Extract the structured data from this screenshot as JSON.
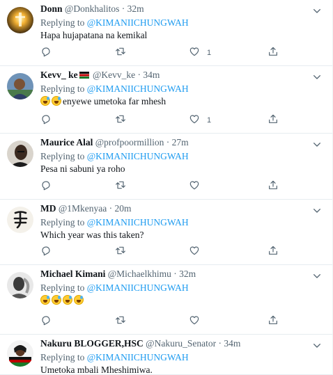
{
  "replying_to": "Replying to",
  "tweets": [
    {
      "name": "Donn",
      "handle": "@Donkhalitos",
      "time": "32m",
      "mention": "@KIMANIICHUNGWAH",
      "text": "Hapa hujapatana na kemikal",
      "like_count": "1",
      "avatar": "sunset-glow-avatar"
    },
    {
      "name": "Kevv_ ke",
      "name_flag": "kenya-flag",
      "handle": "@Kevv_ke",
      "time": "34m",
      "mention": "@KIMANIICHUNGWAH",
      "emoji_count": 2,
      "text": "enyewe umetoka far mhesh",
      "like_count": "1",
      "avatar": "man-photo-avatar"
    },
    {
      "name": "Maurice Alal",
      "handle": "@profpoormillion",
      "time": "27m",
      "mention": "@KIMANIICHUNGWAH",
      "text": "Pesa ni sabuni ya roho",
      "like_count": "",
      "avatar": "bald-man-avatar"
    },
    {
      "name": "MD",
      "handle": "@1Mkenyaa",
      "time": "20m",
      "mention": "@KIMANIICHUNGWAH",
      "text": "Which year was this taken?",
      "like_count": "",
      "avatar": "calligraphy-avatar"
    },
    {
      "name": "Michael Kimani",
      "handle": "@Michaelkhimu",
      "time": "32m",
      "mention": "@KIMANIICHUNGWAH",
      "emoji_count": 4,
      "text": "",
      "like_count": "",
      "avatar": "grayscale-man-avatar"
    },
    {
      "name": "Nakuru BLOGGER,HSC",
      "handle": "@Nakuru_Senator",
      "time": "34m",
      "mention": "@KIMANIICHUNGWAH",
      "text": "Umetoka mbali Mheshimiwa.",
      "like_count": "",
      "avatar": "woman-flag-avatar"
    }
  ],
  "dot": "·",
  "icons": {
    "reply": "reply-icon",
    "retweet": "retweet-icon",
    "like": "heart-icon",
    "share": "share-icon",
    "more": "more-icon"
  },
  "colors": {
    "accent": "#1d9bf0",
    "secondary_text": "#536471",
    "divider": "#e6ecf0"
  }
}
